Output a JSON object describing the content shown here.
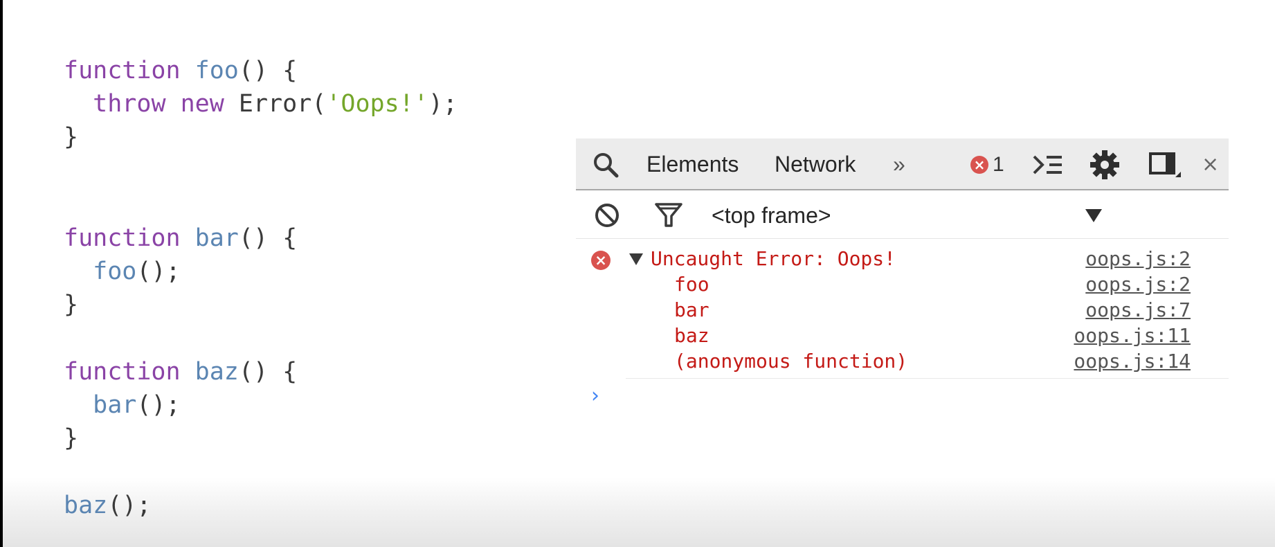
{
  "code": {
    "lines": [
      {
        "kw": "function",
        "fn": "foo",
        "rest": "() {"
      },
      {
        "indent": "  ",
        "kw1": "throw",
        "kw2": "new",
        "plain": "Error(",
        "str": "'Oops!'",
        "end": ");"
      },
      {
        "plain": "}"
      },
      {
        "kw": "function",
        "fn": "bar",
        "rest": "() {"
      },
      {
        "indent": "  ",
        "fn": "foo",
        "rest": "();"
      },
      {
        "plain": "}"
      },
      {
        "kw": "function",
        "fn": "baz",
        "rest": "() {"
      },
      {
        "indent": "  ",
        "fn": "bar",
        "rest": "();"
      },
      {
        "plain": "}"
      },
      {
        "fn": "baz",
        "rest": "();"
      }
    ]
  },
  "devtools": {
    "tabs": [
      "Elements",
      "Network"
    ],
    "more_tabs": "»",
    "error_count": "1",
    "frame_selector": "<top frame>",
    "icons": {
      "search": "search-icon",
      "error_badge": "error-badge-icon",
      "drawer": "console-drawer-icon",
      "settings": "gear-icon",
      "dock": "dock-side-icon",
      "close": "close-icon",
      "clear": "clear-console-icon",
      "filter": "filter-icon",
      "dropdown": "dropdown-arrow-icon"
    },
    "console": {
      "error": {
        "message": "Uncaught Error: Oops!",
        "source": "oops.js:2",
        "stack": [
          {
            "fn": "foo",
            "source": "oops.js:2"
          },
          {
            "fn": "bar",
            "source": "oops.js:7"
          },
          {
            "fn": "baz",
            "source": "oops.js:11"
          },
          {
            "fn": "(anonymous function)",
            "source": "oops.js:14"
          }
        ]
      },
      "prompt": "›"
    }
  },
  "colors": {
    "keyword": "#8a43a6",
    "function": "#5b85b2",
    "string": "#74a62a",
    "error": "#c41a16"
  }
}
